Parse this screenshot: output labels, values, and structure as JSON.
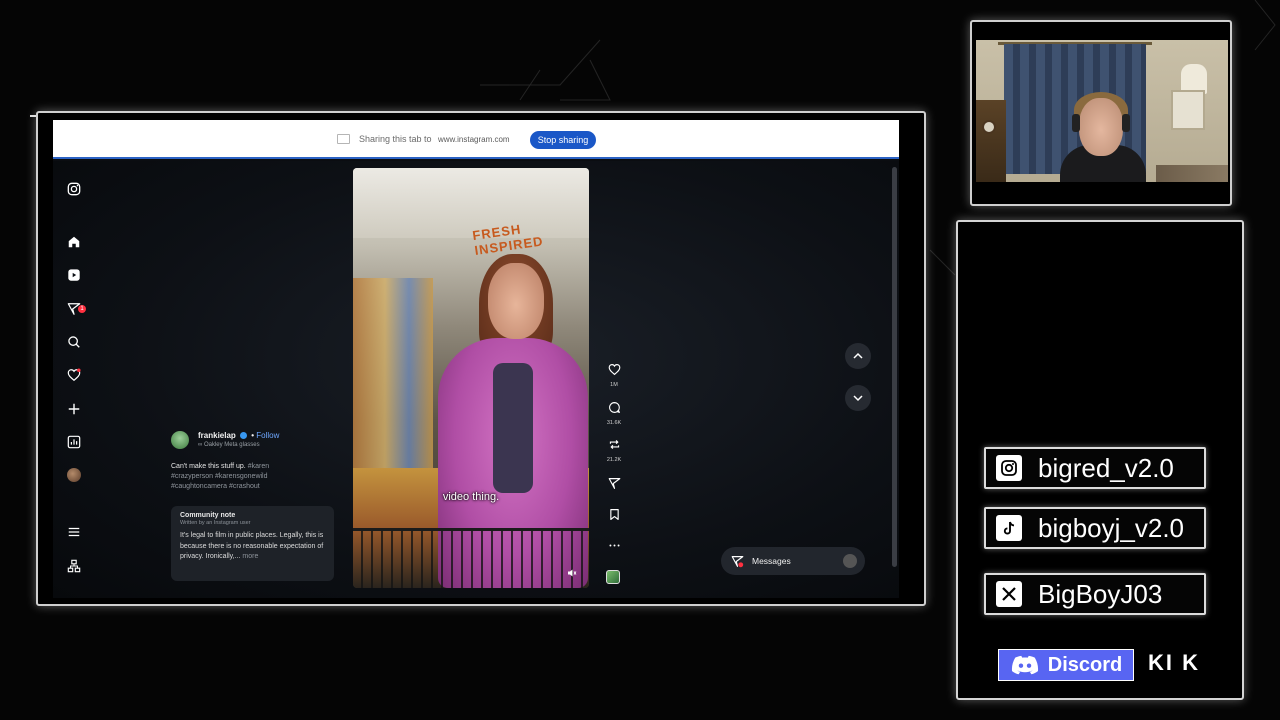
{
  "share_bar": {
    "message": "Sharing this tab to",
    "url": "www.instagram.com",
    "stop_label": "Stop sharing"
  },
  "sidebar": {
    "items": [
      {
        "icon": "instagram-logo-icon"
      },
      {
        "icon": "home-icon"
      },
      {
        "icon": "reels-icon"
      },
      {
        "icon": "messages-icon",
        "badge": "1"
      },
      {
        "icon": "search-icon"
      },
      {
        "icon": "notifications-heart-icon"
      },
      {
        "icon": "create-plus-icon"
      },
      {
        "icon": "dashboard-icon"
      },
      {
        "icon": "profile-avatar"
      },
      {
        "icon": "menu-icon"
      },
      {
        "icon": "threads-icon"
      }
    ]
  },
  "post": {
    "username": "frankielap",
    "follow_label": "Follow",
    "subtitle": "Oakley Meta glasses",
    "caption_text": "Can't make this stuff up.",
    "caption_tags": "#karen #crazyperson #karensgonewild #caughtoncamera #crashout",
    "community_note": {
      "title": "Community note",
      "author": "Written by an Instagram user",
      "body": "It's legal to film in public places. Legally, this is because there is no reasonable expectation of privacy. Ironically,...",
      "more": "more"
    }
  },
  "video": {
    "store_sign": "FRESH INSPIRED",
    "subtitle": "video thing."
  },
  "actions": {
    "likes": "1M",
    "comments": "31.6K",
    "reposts": "21.2K"
  },
  "messages": {
    "label": "Messages",
    "badge": "1"
  },
  "socials": {
    "instagram": "bigred_v2.0",
    "tiktok": "bigboyj_v2.0",
    "x": "BigBoyJ03",
    "discord": "Discord",
    "kick": "KI K"
  },
  "colors": {
    "accent_blue": "#1a57c7",
    "discord": "#5865f2",
    "notification_red": "#ff3040"
  }
}
